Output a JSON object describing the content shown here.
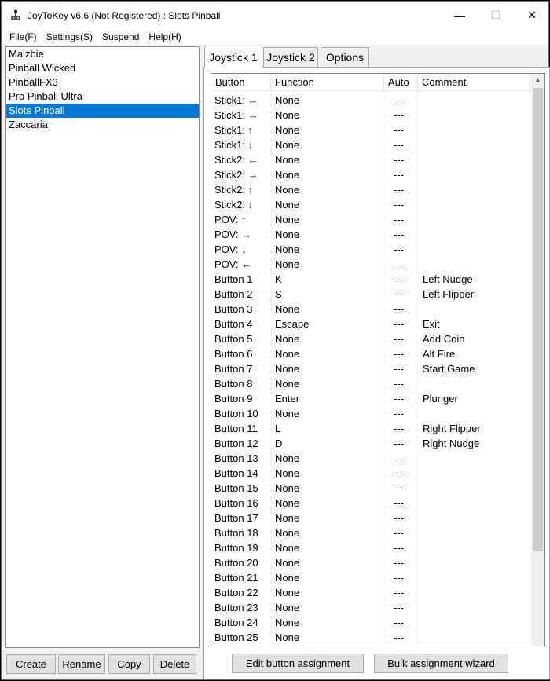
{
  "window": {
    "title": "JoyToKey v6.6 (Not Registered) : Slots Pinball",
    "minimize": "—",
    "maximize": "☐",
    "close": "✕"
  },
  "menu": [
    "File(F)",
    "Settings(S)",
    "Suspend",
    "Help(H)"
  ],
  "profiles": [
    {
      "label": "Malzbie",
      "selected": false
    },
    {
      "label": "Pinball Wicked",
      "selected": false
    },
    {
      "label": "PinballFX3",
      "selected": false
    },
    {
      "label": "Pro Pinball Ultra",
      "selected": false
    },
    {
      "label": "Slots Pinball",
      "selected": true
    },
    {
      "label": "Zaccaria",
      "selected": false
    }
  ],
  "profile_buttons": {
    "create": "Create",
    "rename": "Rename",
    "copy": "Copy",
    "delete": "Delete"
  },
  "tabs": [
    {
      "label": "Joystick 1",
      "active": true
    },
    {
      "label": "Joystick 2",
      "active": false
    },
    {
      "label": "Options",
      "active": false
    }
  ],
  "columns": [
    "Button",
    "Function",
    "Auto",
    "Comment"
  ],
  "rows": [
    {
      "button": "Stick1: ←",
      "function": "None",
      "auto": "---",
      "comment": ""
    },
    {
      "button": "Stick1: →",
      "function": "None",
      "auto": "---",
      "comment": ""
    },
    {
      "button": "Stick1: ↑",
      "function": "None",
      "auto": "---",
      "comment": ""
    },
    {
      "button": "Stick1: ↓",
      "function": "None",
      "auto": "---",
      "comment": ""
    },
    {
      "button": "Stick2: ←",
      "function": "None",
      "auto": "---",
      "comment": ""
    },
    {
      "button": "Stick2: →",
      "function": "None",
      "auto": "---",
      "comment": ""
    },
    {
      "button": "Stick2: ↑",
      "function": "None",
      "auto": "---",
      "comment": ""
    },
    {
      "button": "Stick2: ↓",
      "function": "None",
      "auto": "---",
      "comment": ""
    },
    {
      "button": "POV: ↑",
      "function": "None",
      "auto": "---",
      "comment": ""
    },
    {
      "button": "POV: →",
      "function": "None",
      "auto": "---",
      "comment": ""
    },
    {
      "button": "POV: ↓",
      "function": "None",
      "auto": "---",
      "comment": ""
    },
    {
      "button": "POV: ←",
      "function": "None",
      "auto": "---",
      "comment": ""
    },
    {
      "button": "Button 1",
      "function": "K",
      "auto": "---",
      "comment": "Left Nudge"
    },
    {
      "button": "Button 2",
      "function": "S",
      "auto": "---",
      "comment": "Left Flipper"
    },
    {
      "button": "Button 3",
      "function": "None",
      "auto": "---",
      "comment": ""
    },
    {
      "button": "Button 4",
      "function": "Escape",
      "auto": "---",
      "comment": "Exit"
    },
    {
      "button": "Button 5",
      "function": "None",
      "auto": "---",
      "comment": "Add Coin"
    },
    {
      "button": "Button 6",
      "function": "None",
      "auto": "---",
      "comment": "Alt Fire"
    },
    {
      "button": "Button 7",
      "function": "None",
      "auto": "---",
      "comment": "Start Game"
    },
    {
      "button": "Button 8",
      "function": "None",
      "auto": "---",
      "comment": ""
    },
    {
      "button": "Button 9",
      "function": "Enter",
      "auto": "---",
      "comment": "Plunger"
    },
    {
      "button": "Button 10",
      "function": "None",
      "auto": "---",
      "comment": ""
    },
    {
      "button": "Button 11",
      "function": "L",
      "auto": "---",
      "comment": "Right Flipper"
    },
    {
      "button": "Button 12",
      "function": "D",
      "auto": "---",
      "comment": "Right Nudge"
    },
    {
      "button": "Button 13",
      "function": "None",
      "auto": "---",
      "comment": ""
    },
    {
      "button": "Button 14",
      "function": "None",
      "auto": "---",
      "comment": ""
    },
    {
      "button": "Button 15",
      "function": "None",
      "auto": "---",
      "comment": ""
    },
    {
      "button": "Button 16",
      "function": "None",
      "auto": "---",
      "comment": ""
    },
    {
      "button": "Button 17",
      "function": "None",
      "auto": "---",
      "comment": ""
    },
    {
      "button": "Button 18",
      "function": "None",
      "auto": "---",
      "comment": ""
    },
    {
      "button": "Button 19",
      "function": "None",
      "auto": "---",
      "comment": ""
    },
    {
      "button": "Button 20",
      "function": "None",
      "auto": "---",
      "comment": ""
    },
    {
      "button": "Button 21",
      "function": "None",
      "auto": "---",
      "comment": ""
    },
    {
      "button": "Button 22",
      "function": "None",
      "auto": "---",
      "comment": ""
    },
    {
      "button": "Button 23",
      "function": "None",
      "auto": "---",
      "comment": ""
    },
    {
      "button": "Button 24",
      "function": "None",
      "auto": "---",
      "comment": ""
    },
    {
      "button": "Button 25",
      "function": "None",
      "auto": "---",
      "comment": ""
    }
  ],
  "panel_buttons": {
    "edit": "Edit button assignment",
    "bulk": "Bulk assignment wizard"
  },
  "scroll_up_glyph": "▲",
  "colors": {
    "selection": "#0078d7",
    "window_bg": "#f0f0f0"
  }
}
